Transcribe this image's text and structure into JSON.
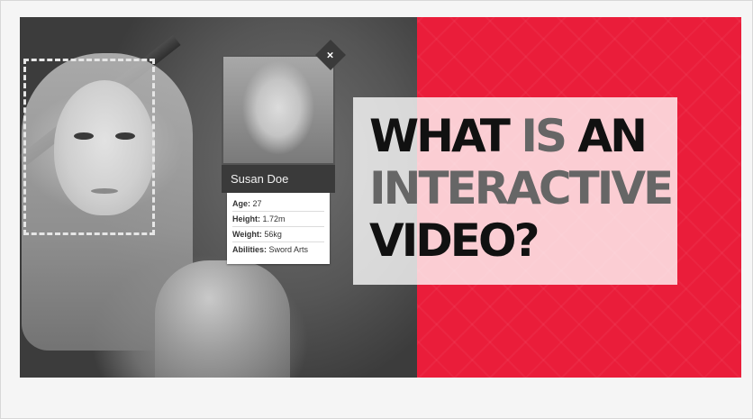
{
  "profile": {
    "name": "Susan Doe",
    "close_glyph": "×",
    "details": [
      {
        "label": "Age:",
        "value": "27"
      },
      {
        "label": "Height:",
        "value": "1.72m"
      },
      {
        "label": "Weight:",
        "value": "56kg"
      },
      {
        "label": "Abilities:",
        "value": "Sword Arts"
      }
    ]
  },
  "title": {
    "line1_a": "WHAT",
    "line1_b": "IS",
    "line1_c": "AN",
    "line2": "INTERACTIVE",
    "line3": "VIDEO?"
  },
  "colors": {
    "accent_red": "#ea1d3a",
    "card_dark": "#3a3a3a"
  }
}
